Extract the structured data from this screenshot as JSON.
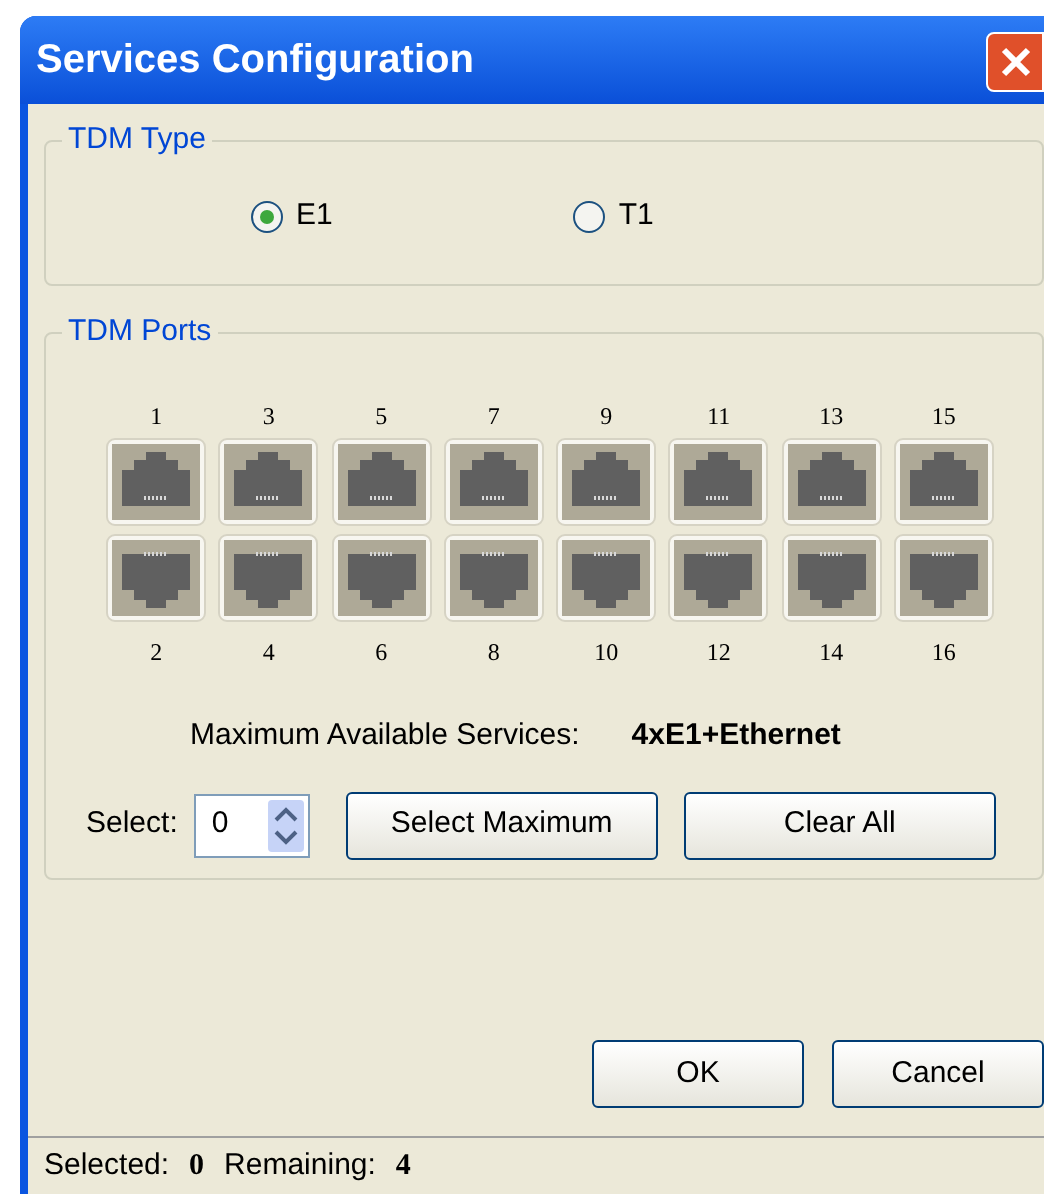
{
  "window": {
    "title": "Services Configuration"
  },
  "tdm_type": {
    "title": "TDM Type",
    "options": [
      {
        "label": "E1",
        "selected": true
      },
      {
        "label": "T1",
        "selected": false
      }
    ]
  },
  "tdm_ports": {
    "title": "TDM Ports",
    "top_row": [
      {
        "label": "1"
      },
      {
        "label": "3"
      },
      {
        "label": "5"
      },
      {
        "label": "7"
      },
      {
        "label": "9"
      },
      {
        "label": "11"
      },
      {
        "label": "13"
      },
      {
        "label": "15"
      }
    ],
    "bottom_row": [
      {
        "label": "2"
      },
      {
        "label": "4"
      },
      {
        "label": "6"
      },
      {
        "label": "8"
      },
      {
        "label": "10"
      },
      {
        "label": "12"
      },
      {
        "label": "14"
      },
      {
        "label": "16"
      }
    ],
    "max_label": "Maximum Available Services:",
    "max_value": "4xE1+Ethernet",
    "select_label": "Select:",
    "select_value": "0",
    "buttons": [
      "Select Maximum",
      "Clear All"
    ]
  },
  "buttons": [
    "OK",
    "Cancel"
  ],
  "status_bar": [
    {
      "label": "Selected:",
      "value": "0"
    },
    {
      "label": "Remaining:",
      "value": "4"
    }
  ]
}
